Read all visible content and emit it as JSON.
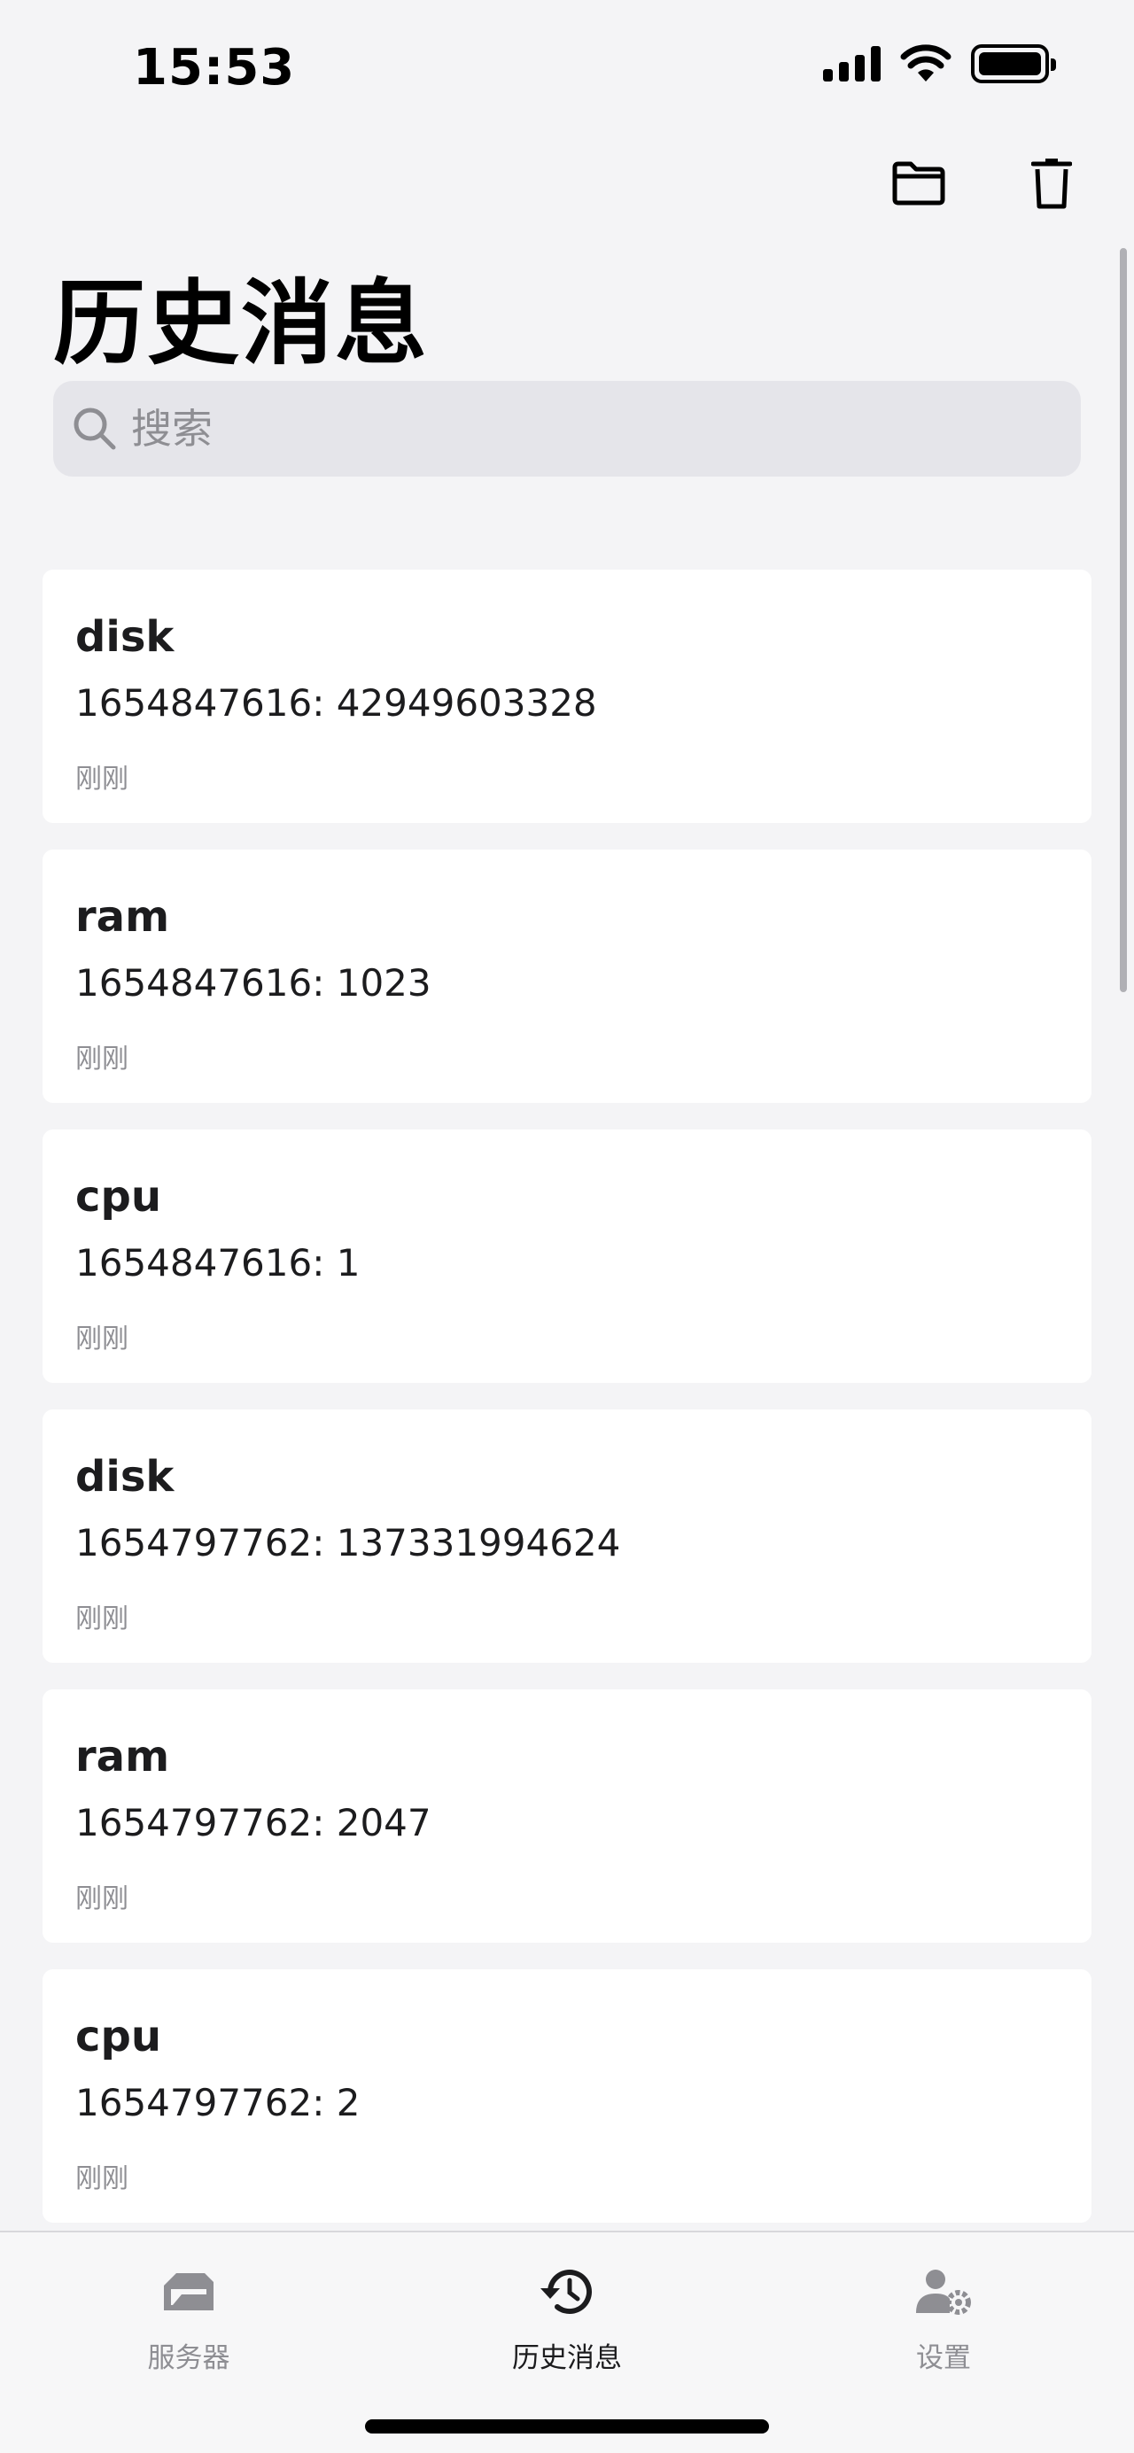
{
  "status_bar": {
    "time": "15:53"
  },
  "header": {
    "title": "历史消息"
  },
  "search": {
    "placeholder": "搜索"
  },
  "messages": [
    {
      "title": "disk",
      "body": "1654847616: 42949603328",
      "time": "刚刚"
    },
    {
      "title": "ram",
      "body": "1654847616: 1023",
      "time": "刚刚"
    },
    {
      "title": "cpu",
      "body": "1654847616: 1",
      "time": "刚刚"
    },
    {
      "title": "disk",
      "body": "1654797762: 137331994624",
      "time": "刚刚"
    },
    {
      "title": "ram",
      "body": "1654797762: 2047",
      "time": "刚刚"
    },
    {
      "title": "cpu",
      "body": "1654797762: 2",
      "time": "刚刚"
    }
  ],
  "tabs": [
    {
      "label": "服务器",
      "icon": "server-icon",
      "active": false
    },
    {
      "label": "历史消息",
      "icon": "history-icon",
      "active": true
    },
    {
      "label": "设置",
      "icon": "user-settings-icon",
      "active": false
    }
  ],
  "colors": {
    "background": "#f4f4f6",
    "card": "#ffffff",
    "inactive": "#8e8e93",
    "active": "#1c1c1e"
  }
}
